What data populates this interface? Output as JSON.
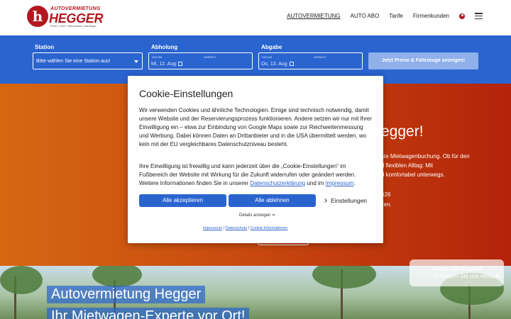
{
  "header": {
    "logo": {
      "top": "AUTOVERMIETUNG",
      "main": "HEGGER",
      "sub": "PKW / LKW / Wohnmobil / Anhänger"
    },
    "nav": [
      {
        "label": "AUTOVERMIETUNG",
        "active": true
      },
      {
        "label": "AUTO ABO",
        "active": false
      },
      {
        "label": "Tarife",
        "active": false
      },
      {
        "label": "Firmenkunden",
        "active": false
      }
    ]
  },
  "booking": {
    "station_label": "Station",
    "station_placeholder": "Bitte wählen Sie eine Station aus!",
    "pickup_label": "Abholung",
    "pickup_date_caption": "DATUM",
    "pickup_time_caption": "UHRZEIT",
    "pickup_date": "Mi, 12. Aug",
    "return_label": "Abgabe",
    "return_date_caption": "DATUM",
    "return_time_caption": "UHRZEIT",
    "return_date": "Do, 13. Aug",
    "search_button": "Jetzt Preise & Fahrzeuge anzeigen!"
  },
  "hero": {
    "title_fragment": "egger!",
    "lines": [
      "ste Mietwagenbuchung. Ob für den",
      "d flexiblen Alltag: Mit",
      "d komfortabel unterwegs.",
      "626",
      "llen."
    ]
  },
  "photo": {
    "title": "Autovermietung Hegger",
    "subtitle": "Ihr Mietwagen-Experte vor Ort!"
  },
  "chat": {
    "line1": "Haben Sie Fragen?",
    "line2": "Schreiben Sie uns einfach!"
  },
  "cookie": {
    "title": "Cookie-Einstellungen",
    "para1": "Wir verwenden Cookies und ähnliche Technologien. Einige sind technisch notwendig, damit unsere Website und der Reservierungsprozess funktionieren. Andere setzen wir nur mit Ihrer Einwilligung ein – etwa zur Einbindung von Google Maps sowie zur Reichweitenmessung und Werbung. Dabei können Daten an Drittanbieter und in die USA übermittelt werden, wo kein mit der EU vergleichbares Datenschutzniveau besteht.",
    "para2_a": "Ihre Einwilligung ist freiwillig und kann jederzeit über die „Cookie-Einstellungen“ im Fußbereich der Website mit Wirkung für die Zukunft widerrufen oder geändert werden. Weitere Informationen finden Sie in unserer ",
    "para2_link1": "Datenschutzerklärung",
    "para2_b": " und im ",
    "para2_link2": "Impressum",
    "para2_c": ".",
    "accept_all": "Alle akzeptieren",
    "reject_all": "Alle ablehnen",
    "settings": "Einstellungen",
    "details": "Details anzeigen",
    "footer_links": [
      "Impressum",
      "Datenschutz",
      "Cookie-Informationen"
    ]
  },
  "colors": {
    "brand_red": "#b3171f",
    "primary_blue": "#2a64cf",
    "hero_orange": "#d66712"
  }
}
